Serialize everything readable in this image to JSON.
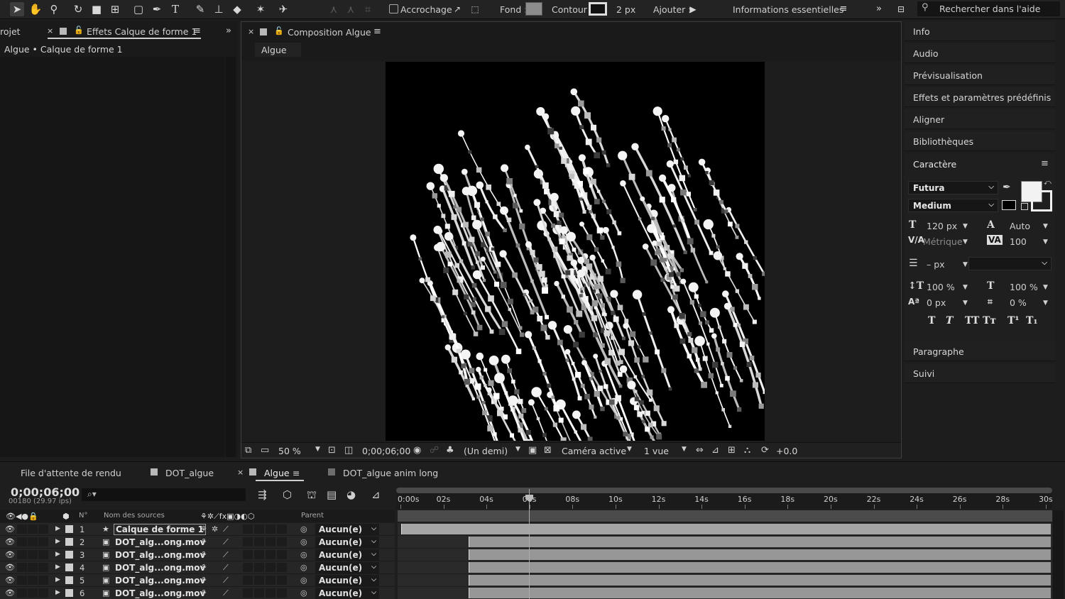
{
  "toolbar": {
    "snap_label": "Accrochage",
    "fill_label": "Fond :",
    "stroke_label": "Contour :",
    "stroke_width": "2 px",
    "add_label": "Ajouter :",
    "workspace": "Informations essentielles",
    "search_placeholder": "Rechercher dans l'aide"
  },
  "effects_panel": {
    "project_tab": "rojet",
    "tab_label": "Effets  Calque de forme 1",
    "breadcrumb": "Algue • Calque de forme 1"
  },
  "comp_panel": {
    "tab_label": "Composition  Algue",
    "subtab": "Algue",
    "zoom": "50 %",
    "timecode": "0;00;06;00",
    "resolution": "(Un demi)",
    "camera": "Caméra active",
    "views": "1 vue",
    "exposure": "+0.0"
  },
  "right_panels": {
    "items": [
      "Info",
      "Audio",
      "Prévisualisation",
      "Effets et paramètres prédéfinis",
      "Aligner",
      "Bibliothèques"
    ],
    "character": {
      "title": "Caractère",
      "font_family": "Futura",
      "font_style": "Medium",
      "font_size": "120 px",
      "leading": "Auto",
      "kerning": "Métrique",
      "tracking": "100",
      "stroke_width": "– px",
      "vert_scale": "100 %",
      "horiz_scale": "100 %",
      "baseline": "0 px",
      "tsume": "0 %"
    },
    "bottom_items": [
      "Paragraphe",
      "Suivi"
    ]
  },
  "timeline": {
    "tabs": [
      "File d'attente de rendu",
      "DOT_algue",
      "Algue",
      "DOT_algue anim long"
    ],
    "current_time": "0;00;06;00",
    "frames": "00180 (29.97 ips)",
    "search_icon": "⌕▾",
    "col_num": "N°",
    "col_source": "Nom des sources",
    "col_parent": "Parent",
    "ruler_labels": [
      "0:00s",
      "02s",
      "04s",
      "06s",
      "08s",
      "10s",
      "12s",
      "14s",
      "16s",
      "18s",
      "20s",
      "22s",
      "24s",
      "26s",
      "28s",
      "30s"
    ],
    "layers": [
      {
        "num": "1",
        "name": "Calque de forme 1",
        "parent": "Aucun(e)"
      },
      {
        "num": "2",
        "name": "DOT_alg...ong.mov",
        "parent": "Aucun(e)"
      },
      {
        "num": "3",
        "name": "DOT_alg...ong.mov",
        "parent": "Aucun(e)"
      },
      {
        "num": "4",
        "name": "DOT_alg...ong.mov",
        "parent": "Aucun(e)"
      },
      {
        "num": "5",
        "name": "DOT_alg...ong.mov",
        "parent": "Aucun(e)"
      },
      {
        "num": "6",
        "name": "DOT_alg...ong.mov",
        "parent": "Aucun(e)"
      }
    ]
  }
}
